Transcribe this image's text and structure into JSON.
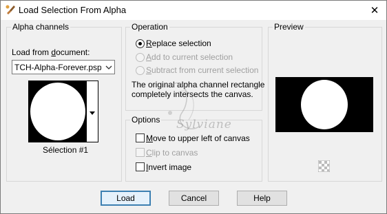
{
  "window": {
    "title": "Load Selection From Alpha",
    "close_glyph": "✕"
  },
  "alpha_channels": {
    "legend": "Alpha channels",
    "load_from_pre": "Load from ",
    "load_from_accel": "d",
    "load_from_post": "ocument:",
    "document_value": "TCH-Alpha-Forever.pspimage",
    "selection_name": "Sélection #1"
  },
  "operation": {
    "legend": "Operation",
    "replace": {
      "accel": "R",
      "rest": "eplace selection",
      "checked": true,
      "enabled": true
    },
    "add": {
      "accel": "A",
      "rest": "dd to current selection",
      "checked": false,
      "enabled": false
    },
    "subtract": {
      "accel": "S",
      "rest": "ubtract from current selection",
      "checked": false,
      "enabled": false
    },
    "message_line1": "The original alpha channel rectangle",
    "message_line2": "completely intersects the canvas."
  },
  "options": {
    "legend": "Options",
    "move": {
      "accel": "M",
      "rest": "ove to upper left of canvas",
      "checked": false,
      "enabled": true
    },
    "clip": {
      "accel": "C",
      "rest": "lip to canvas",
      "checked": false,
      "enabled": false
    },
    "invert": {
      "accel": "I",
      "rest": "nvert image",
      "checked": false,
      "enabled": true
    }
  },
  "preview": {
    "legend": "Preview"
  },
  "buttons": {
    "load": "Load",
    "cancel": "Cancel",
    "help": "Help"
  },
  "watermark": {
    "text": "Sylviane"
  },
  "icons": {
    "title": "paint-brush-icon",
    "close": "close-icon",
    "dropdown": "chevron-down-icon",
    "checker": "transparency-checker-icon"
  }
}
